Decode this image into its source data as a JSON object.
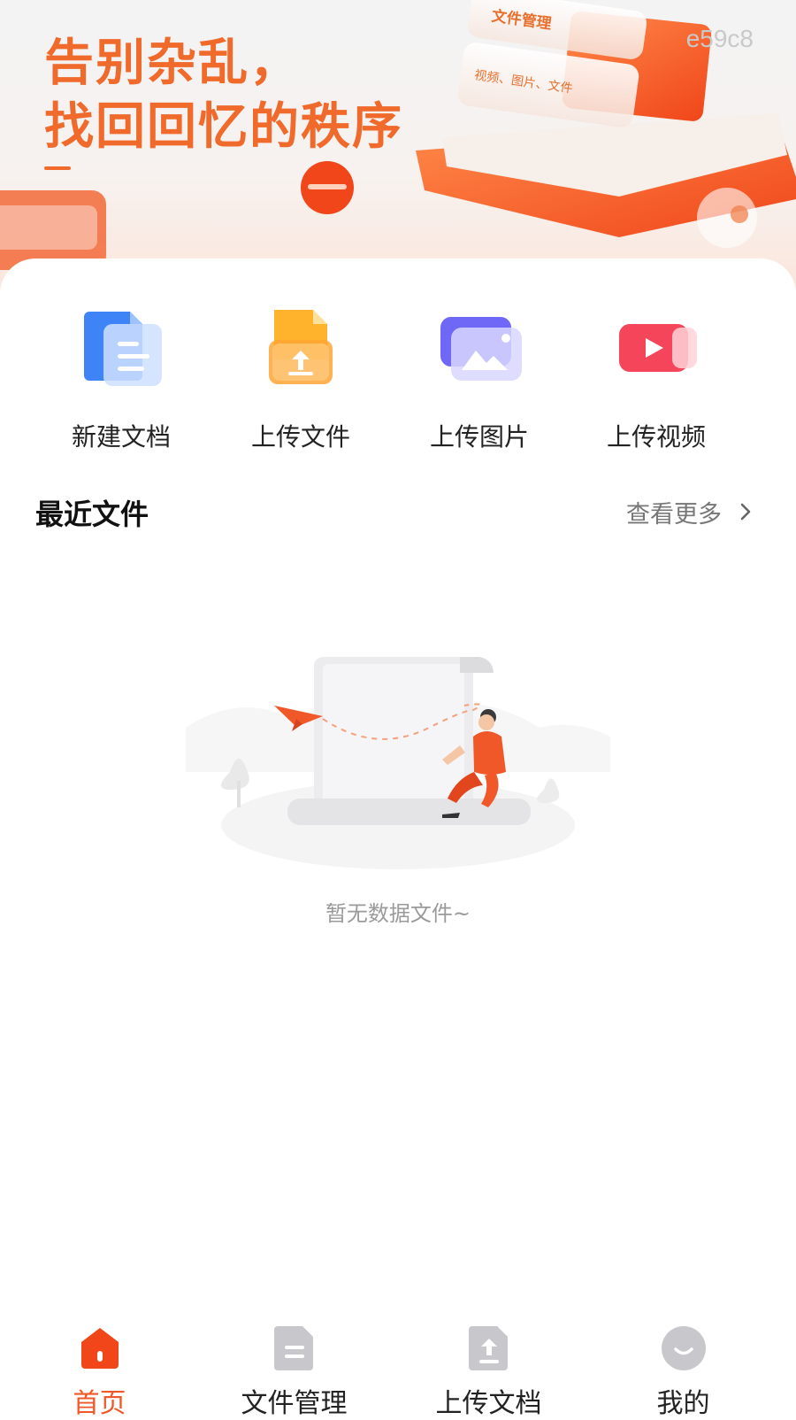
{
  "banner": {
    "title_line1": "告别杂乱，",
    "title_line2": "找回回忆的秩序",
    "card_label": "文件管理",
    "card_sub": "视频、图片、文件",
    "watermark": "e59c8"
  },
  "actions": [
    {
      "label": "新建文档",
      "icon": "new-document-icon"
    },
    {
      "label": "上传文件",
      "icon": "upload-file-icon"
    },
    {
      "label": "上传图片",
      "icon": "upload-image-icon"
    },
    {
      "label": "上传视频",
      "icon": "upload-video-icon"
    }
  ],
  "recent": {
    "title": "最近文件",
    "see_more": "查看更多",
    "empty_text": "暂无数据文件~"
  },
  "tabbar": [
    {
      "label": "首页",
      "icon": "home-icon",
      "active": true
    },
    {
      "label": "文件管理",
      "icon": "file-manage-icon",
      "active": false
    },
    {
      "label": "上传文档",
      "icon": "upload-document-icon",
      "active": false
    },
    {
      "label": "我的",
      "icon": "profile-icon",
      "active": false
    }
  ],
  "colors": {
    "accent": "#f0582a",
    "banner_text": "#f06a2c",
    "text_primary": "#222222",
    "text_secondary": "#777777"
  }
}
